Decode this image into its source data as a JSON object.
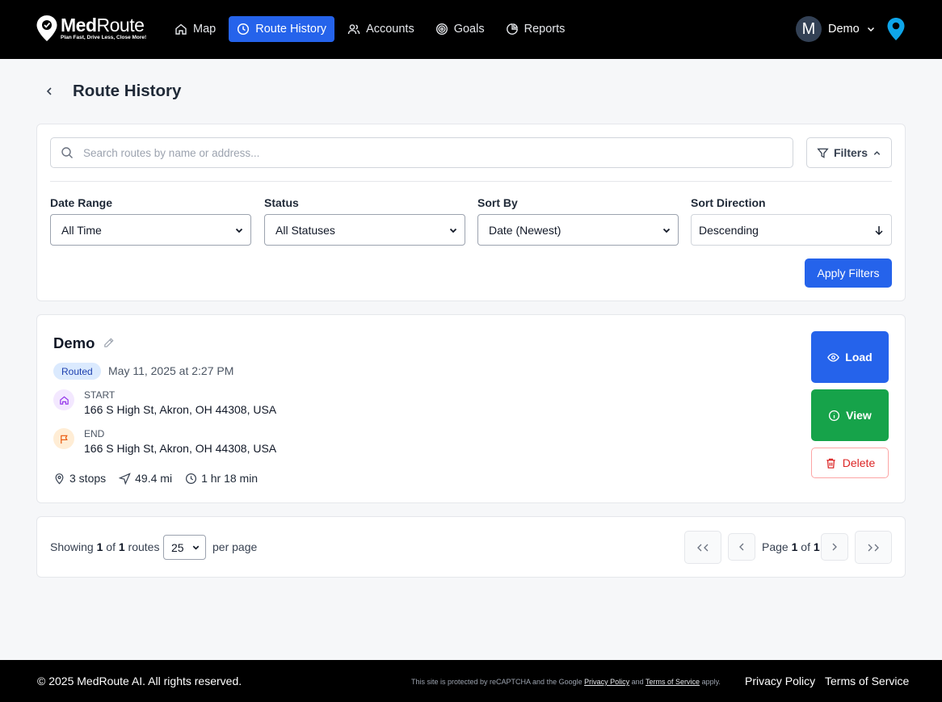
{
  "brand": {
    "name_bold": "Med",
    "name_light": "Route",
    "tagline": "Plan Fast, Drive Less, Close More!"
  },
  "nav": {
    "items": [
      {
        "label": "Map",
        "icon": "home-icon"
      },
      {
        "label": "Route History",
        "icon": "clock-icon",
        "active": true
      },
      {
        "label": "Accounts",
        "icon": "users-icon"
      },
      {
        "label": "Goals",
        "icon": "target-icon"
      },
      {
        "label": "Reports",
        "icon": "pie-chart-icon"
      }
    ],
    "user": {
      "initial": "M",
      "name": "Demo"
    }
  },
  "page": {
    "title": "Route History"
  },
  "filters": {
    "search_placeholder": "Search routes by name or address...",
    "toggle_label": "Filters",
    "date_range": {
      "label": "Date Range",
      "value": "All Time"
    },
    "status": {
      "label": "Status",
      "value": "All Statuses"
    },
    "sort_by": {
      "label": "Sort By",
      "value": "Date (Newest)"
    },
    "sort_direction": {
      "label": "Sort Direction",
      "value": "Descending"
    },
    "apply_label": "Apply Filters"
  },
  "route": {
    "name": "Demo",
    "status": "Routed",
    "date": "May 11, 2025 at 2:27 PM",
    "start_label": "START",
    "start_address": "166 S High St, Akron, OH 44308, USA",
    "end_label": "END",
    "end_address": "166 S High St, Akron, OH 44308, USA",
    "stops": "3 stops",
    "distance": "49.4 mi",
    "duration": "1 hr 18 min",
    "load_label": "Load",
    "view_label": "View",
    "delete_label": "Delete"
  },
  "pagination": {
    "showing_prefix": "Showing",
    "showing_from": "1",
    "showing_of": "of",
    "showing_total": "1",
    "showing_suffix": "routes",
    "per_page_value": "25",
    "per_page_label": "per page",
    "page_prefix": "Page",
    "page_current": "1",
    "page_of": "of",
    "page_total": "1"
  },
  "footer": {
    "copyright": "© 2025 MedRoute AI. All rights reserved.",
    "recaptcha_prefix": "This site is protected by reCAPTCHA and the Google",
    "recaptcha_privacy": "Privacy Policy",
    "recaptcha_and": "and",
    "recaptcha_terms": "Terms of Service",
    "recaptcha_suffix": "apply.",
    "privacy_link": "Privacy Policy",
    "terms_link": "Terms of Service"
  },
  "colors": {
    "accent": "#2563eb",
    "success": "#16a34a",
    "danger": "#dc2626",
    "topbar": "#000000"
  }
}
